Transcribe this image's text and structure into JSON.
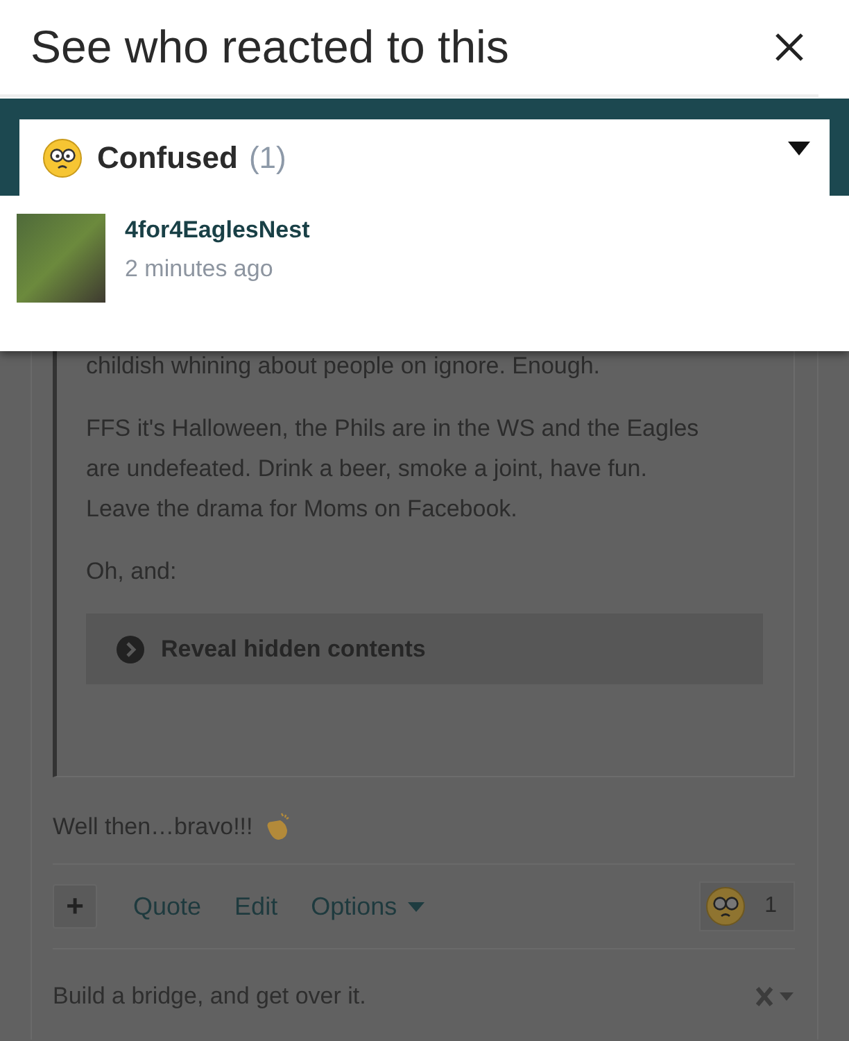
{
  "modal": {
    "title": "See who reacted to this",
    "reaction_tab": {
      "label": "Confused",
      "count": "(1)",
      "expanded": false
    },
    "users": [
      {
        "name": "4for4EaglesNest",
        "time": "2 minutes ago"
      }
    ]
  },
  "post": {
    "quote_paragraphs": [
      "childish whining about people on ignore.  Enough.",
      "FFS it's Halloween, the Phils are in the WS and the Eagles are undefeated.  Drink a beer, smoke a joint, have fun. Leave the drama for Moms on Facebook.",
      "Oh, and:"
    ],
    "hidden_toggle": "Reveal hidden contents",
    "body": "Well then…bravo!!!",
    "actions": [
      {
        "label": "Quote",
        "menu": false
      },
      {
        "label": "Edit",
        "menu": false
      },
      {
        "label": "Options",
        "menu": true
      }
    ],
    "add_button": "+",
    "reaction_count": "1",
    "signature": "Build a bridge, and get over it."
  }
}
